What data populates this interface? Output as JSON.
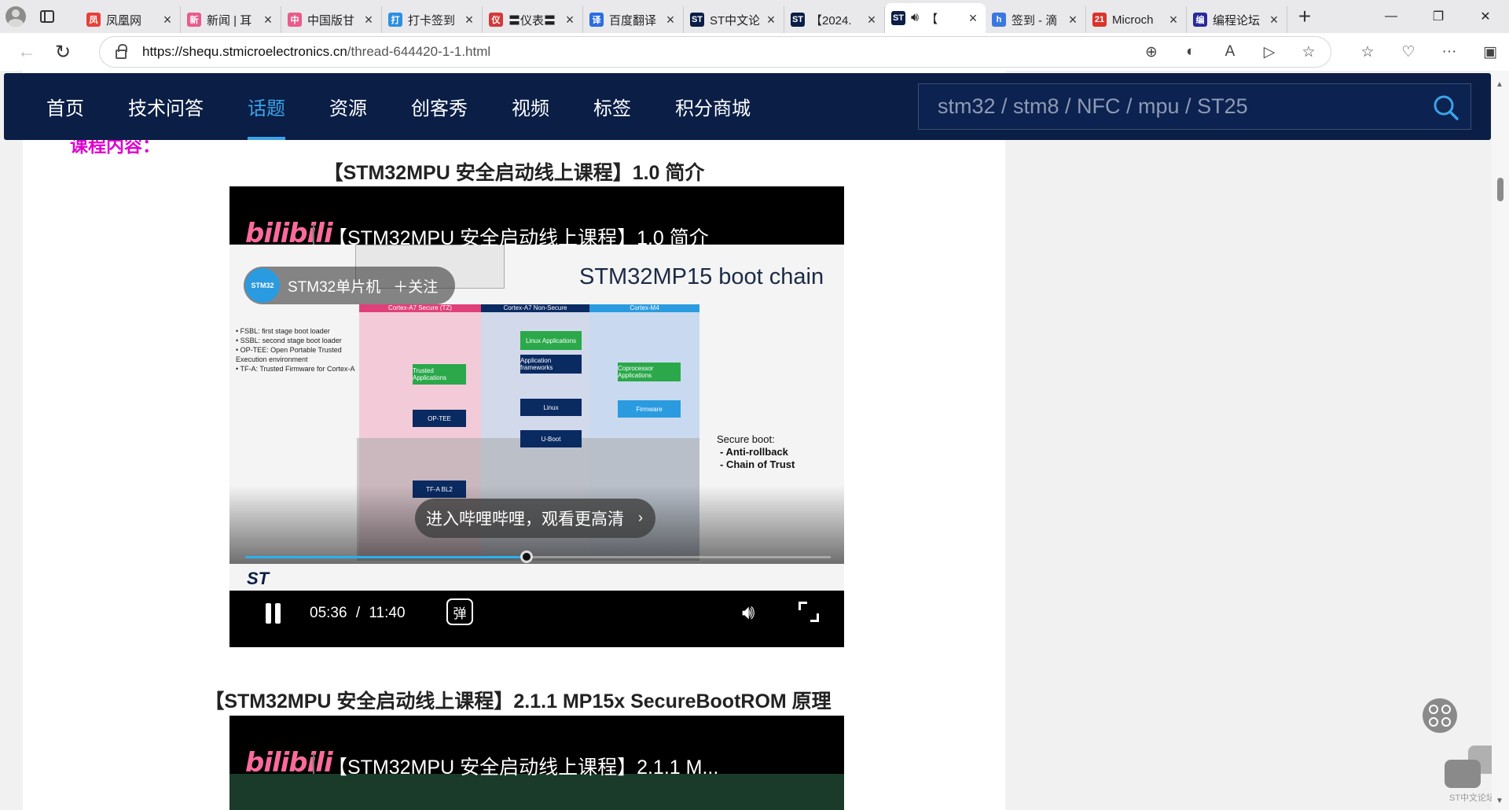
{
  "browser": {
    "tabs": [
      {
        "title": "凤凰网",
        "fav_color": "#e8403a",
        "fav_char": "凤",
        "active": false
      },
      {
        "title": "新闻 | 耳",
        "fav_color": "#e85c8a",
        "fav_char": "新",
        "active": false
      },
      {
        "title": "中国版甘",
        "fav_color": "#e85c8a",
        "fav_char": "中",
        "active": false
      },
      {
        "title": "打卡签到",
        "fav_color": "#2c8fe0",
        "fav_char": "打",
        "active": false
      },
      {
        "title": "〓仪表〓",
        "fav_color": "#d23a3a",
        "fav_char": "仪",
        "active": false
      },
      {
        "title": "百度翻译",
        "fav_color": "#2b6de0",
        "fav_char": "译",
        "active": false
      },
      {
        "title": "ST中文论",
        "fav_color": "#0a1e46",
        "fav_char": "ST",
        "active": false
      },
      {
        "title": "【2024.",
        "fav_color": "#0a1e46",
        "fav_char": "ST",
        "active": false
      },
      {
        "title": "【",
        "fav_color": "#0a1e46",
        "fav_char": "ST",
        "active": true
      },
      {
        "title": "签到 - 滴",
        "fav_color": "#3a78e0",
        "fav_char": "h",
        "active": false
      },
      {
        "title": "Microch",
        "fav_color": "#d9342b",
        "fav_char": "21",
        "active": false
      },
      {
        "title": "编程论坛",
        "fav_color": "#2a2a9a",
        "fav_char": "编",
        "active": false
      }
    ],
    "url_host": "https://shequ.stmicroelectronics.cn",
    "url_path": "/thread-644420-1-1.html"
  },
  "site_nav": {
    "items": [
      "首页",
      "技术问答",
      "话题",
      "资源",
      "创客秀",
      "视频",
      "标签",
      "积分商城"
    ],
    "active_index": 2,
    "search_placeholder": "stm32 / stm8 / NFC / mpu / ST25"
  },
  "content": {
    "partial_heading": "课程内容：",
    "video1": {
      "heading": "【STM32MPU 安全启动线上课程】1.0 简介",
      "player_title": "【STM32MPU 安全启动线上课程】1.0 简介",
      "brand": "bilibili",
      "uploader": "STM32单片机",
      "follow": "＋关注",
      "uploader_avatar": "STM32",
      "hint": "进入哔哩哔哩，观看更高清",
      "time_current": "05:36",
      "time_sep": "/",
      "time_total": "11:40",
      "danmu": "弹",
      "progress": 0.48,
      "slide": {
        "title": "STM32MP15 boot chain",
        "bullets": "• FSBL: first stage boot loader\n• SSBL: second stage boot loader\n• OP-TEE: Open Portable Trusted Execution environment\n• TF-A: Trusted Firmware for Cortex-A",
        "col_heads": [
          "Cortex-A7 Secure (TZ)",
          "Cortex-A7 Non-Secure",
          "Cortex-M4"
        ],
        "boxes": [
          "Trusted Applications",
          "OP-TEE",
          "TF-A BL2",
          "Linux Applications",
          "Application frameworks",
          "Linux",
          "U-Boot",
          "Coprocessor Applications",
          "Firmware"
        ],
        "secure_title": "Secure boot:",
        "secure_items": [
          "- Anti-rollback",
          "- Chain of Trust"
        ],
        "st_logo": "ST"
      }
    },
    "video2": {
      "heading": "【STM32MPU 安全启动线上课程】2.1.1 MP15x SecureBootROM 原理",
      "player_title": "【STM32MPU 安全启动线上课程】2.1.1 M...",
      "brand": "bilibili"
    }
  },
  "widgets": {
    "chat_label": "ST中文论坛"
  }
}
